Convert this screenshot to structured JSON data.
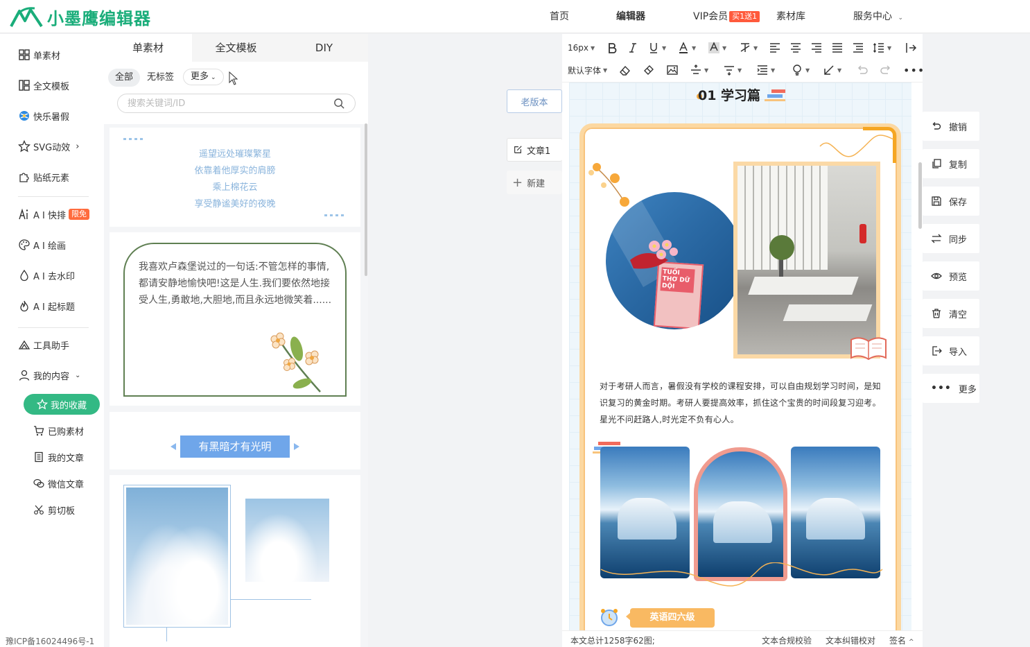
{
  "header": {
    "logo_text": "小墨鹰编辑器",
    "nav": {
      "home": "首页",
      "editor": "编辑器",
      "vip": "VIP会员",
      "vip_badge": "买1送1",
      "library": "素材库",
      "service": "服务中心"
    }
  },
  "sidebar": {
    "items": [
      {
        "label": "单素材",
        "icon": "grid-icon"
      },
      {
        "label": "全文模板",
        "icon": "template-icon"
      },
      {
        "label": "快乐暑假",
        "icon": "ball-icon"
      },
      {
        "label": "SVG动效",
        "icon": "star-icon"
      },
      {
        "label": "贴纸元素",
        "icon": "puzzle-icon"
      },
      {
        "label": "A I 快排",
        "icon": "ai-icon",
        "badge": "限免"
      },
      {
        "label": "A I 绘画",
        "icon": "palette-icon"
      },
      {
        "label": "A I 去水印",
        "icon": "drop-icon"
      },
      {
        "label": "A I 起标题",
        "icon": "flame-icon"
      },
      {
        "label": "工具助手",
        "icon": "tools-icon"
      },
      {
        "label": "我的内容",
        "icon": "user-icon"
      }
    ],
    "sub_items": {
      "favorites": "我的收藏",
      "purchased": "已购素材",
      "articles": "我的文章",
      "wechat": "微信文章",
      "clipboard": "剪切板"
    },
    "icp": "豫ICP备16024496号-1"
  },
  "panel": {
    "tabs": [
      "单素材",
      "全文模板",
      "DIY"
    ],
    "filters": [
      "全部",
      "无标签",
      "更多"
    ],
    "search_placeholder": "搜索关键词/ID",
    "poem": [
      "遥望远处璀璨繁星",
      "依靠着他厚实的肩膀",
      "乘上棉花云",
      "享受静谧美好的夜晚"
    ],
    "quote": "我喜欢卢森堡说过的一句话:不管怎样的事情,都请安静地愉快吧!这是人生.我们要依然地接受人生,勇敢地,大胆地,而且永远地微笑着......",
    "banner": "有黑暗才有光明"
  },
  "middle": {
    "old_version": "老版本",
    "article": "文章1",
    "new": "新建"
  },
  "toolbar": {
    "font_size": "16px",
    "font_family": "默认字体"
  },
  "canvas": {
    "heading": "01 学习篇",
    "paragraph": "对于考研人而言，暑假没有学校的课程安排，可以自由规划学习时间，是知识复习的黄金时期。考研人要提高效率，抓住这个宝贵的时间段复习迎考。星光不问赶路人,时光定不负有心人。",
    "book_title": "TUỔI THƠ DỮ DỘI",
    "tag": "英语四六级"
  },
  "status": {
    "count": "本文总计1258字62图;",
    "compliance": "文本合规校验",
    "proofread": "文本纠错校对",
    "sign": "签名"
  },
  "right_panel": [
    "撤销",
    "复制",
    "保存",
    "同步",
    "预览",
    "清空",
    "导入",
    "更多"
  ],
  "colors": {
    "brand": "#1aad7a",
    "accent_green": "#33b984",
    "frame_orange": "#f8c37c",
    "banner_blue": "#6fa6ea"
  }
}
